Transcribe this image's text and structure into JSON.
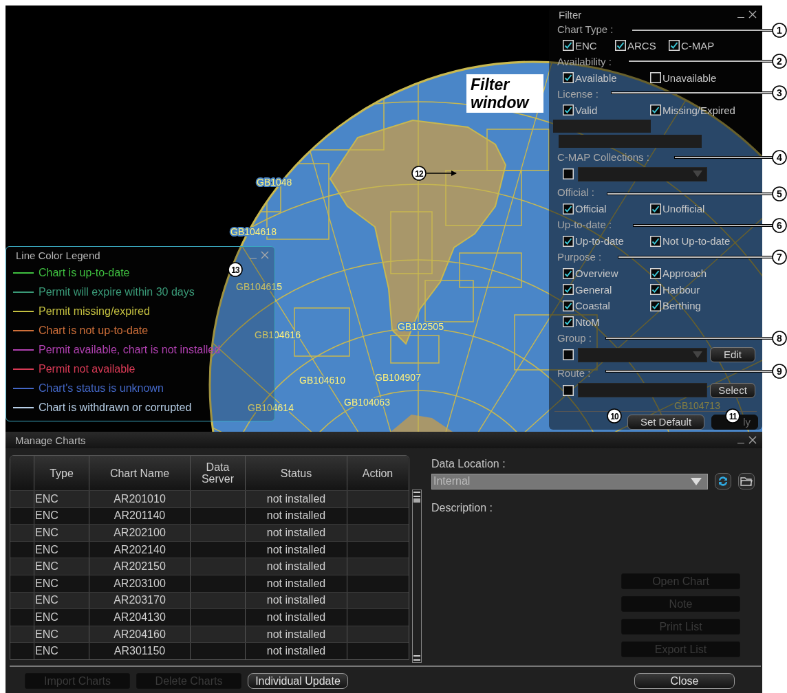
{
  "map": {
    "chart_labels": [
      "GB1048",
      "GB104618",
      "GB104615",
      "GB104616",
      "GB104610",
      "GB104907",
      "GB104063",
      "GB104614",
      "GB102505",
      "GB104713"
    ]
  },
  "filter_window": {
    "title": "Filter",
    "sections": [
      {
        "kind": "checkboxes",
        "label": "Chart Type :",
        "items": [
          {
            "label": "ENC",
            "checked": true
          },
          {
            "label": "ARCS",
            "checked": true
          },
          {
            "label": "C-MAP",
            "checked": true
          }
        ]
      },
      {
        "kind": "checkboxes",
        "label": "Availability :",
        "items": [
          {
            "label": "Available",
            "checked": true
          },
          {
            "label": "Unavailable",
            "checked": false
          }
        ]
      },
      {
        "kind": "checkboxes",
        "label": "License :",
        "items": [
          {
            "label": "Valid",
            "checked": true
          },
          {
            "label": "Missing/Expired",
            "checked": true
          }
        ]
      },
      {
        "kind": "blank_bars"
      },
      {
        "kind": "dropdown",
        "label": "C-MAP Collections :",
        "checked": false
      },
      {
        "kind": "checkboxes",
        "label": "Official :",
        "items": [
          {
            "label": "Official",
            "checked": true
          },
          {
            "label": "Unofficial",
            "checked": true
          }
        ]
      },
      {
        "kind": "checkboxes",
        "label": "Up-to-date :",
        "items": [
          {
            "label": "Up-to-date",
            "checked": true
          },
          {
            "label": "Not Up-to-date",
            "checked": true
          }
        ]
      },
      {
        "kind": "checkboxes",
        "label": "Purpose :",
        "items": [
          {
            "label": "Overview",
            "checked": true
          },
          {
            "label": "Approach",
            "checked": true
          },
          {
            "label": "General",
            "checked": true
          },
          {
            "label": "Harbour",
            "checked": true
          },
          {
            "label": "Coastal",
            "checked": true
          },
          {
            "label": "Berthing",
            "checked": true
          },
          {
            "label": "NtoM",
            "checked": true
          }
        ]
      },
      {
        "kind": "dropdown",
        "label": "Group :",
        "checked": false,
        "button": "Edit"
      },
      {
        "kind": "field",
        "label": "Route :",
        "checked": false,
        "button": "Select"
      }
    ],
    "buttons": [
      {
        "label": "Set Default",
        "disabled": false
      },
      {
        "label": "ly",
        "disabled": true
      }
    ]
  },
  "legend_window": {
    "title": "Line Color Legend",
    "items": [
      {
        "label": "Chart is up-to-date",
        "color": "#3fc040"
      },
      {
        "label": "Permit will expire within 30 days",
        "color": "#3a9a78"
      },
      {
        "label": "Permit missing/expired",
        "color": "#c4c040"
      },
      {
        "label": "Chart is not up-to-date",
        "color": "#d0703a"
      },
      {
        "label": "Permit available, chart is not installed",
        "color": "#b040b0"
      },
      {
        "label": "Permit not available",
        "color": "#d83a55"
      },
      {
        "label": "Chart's status is unknown",
        "color": "#4468c8"
      },
      {
        "label": "Chart is withdrawn or corrupted",
        "color": "#b8d0e8"
      }
    ]
  },
  "manage_charts": {
    "title": "Manage Charts",
    "table": {
      "columns": [
        "Type",
        "Chart Name",
        "Data Server",
        "Status",
        "Action"
      ],
      "rows": [
        [
          "ENC",
          "AR201010",
          "",
          "not installed",
          ""
        ],
        [
          "ENC",
          "AR201140",
          "",
          "not installed",
          ""
        ],
        [
          "ENC",
          "AR202100",
          "",
          "not installed",
          ""
        ],
        [
          "ENC",
          "AR202140",
          "",
          "not installed",
          ""
        ],
        [
          "ENC",
          "AR202150",
          "",
          "not installed",
          ""
        ],
        [
          "ENC",
          "AR203100",
          "",
          "not installed",
          ""
        ],
        [
          "ENC",
          "AR203170",
          "",
          "not installed",
          ""
        ],
        [
          "ENC",
          "AR204130",
          "",
          "not installed",
          ""
        ],
        [
          "ENC",
          "AR204160",
          "",
          "not installed",
          ""
        ],
        [
          "ENC",
          "AR301150",
          "",
          "not installed",
          ""
        ]
      ]
    },
    "data_location": {
      "label": "Data Location :",
      "value": "Internal"
    },
    "description_label": "Description :",
    "side_buttons": [
      {
        "label": "Open Chart",
        "disabled": true
      },
      {
        "label": "Note",
        "disabled": true
      },
      {
        "label": "Print List",
        "disabled": true
      },
      {
        "label": "Export List",
        "disabled": true
      }
    ],
    "bottom_buttons": [
      {
        "label": "Import Charts",
        "disabled": true
      },
      {
        "label": "Delete Charts",
        "disabled": true
      },
      {
        "label": "Individual Update",
        "disabled": false
      }
    ],
    "close_button": "Close"
  },
  "annotation": "Filter window",
  "callouts": [
    "1",
    "2",
    "3",
    "4",
    "5",
    "6",
    "7",
    "8",
    "9",
    "10",
    "11",
    "12",
    "13"
  ]
}
